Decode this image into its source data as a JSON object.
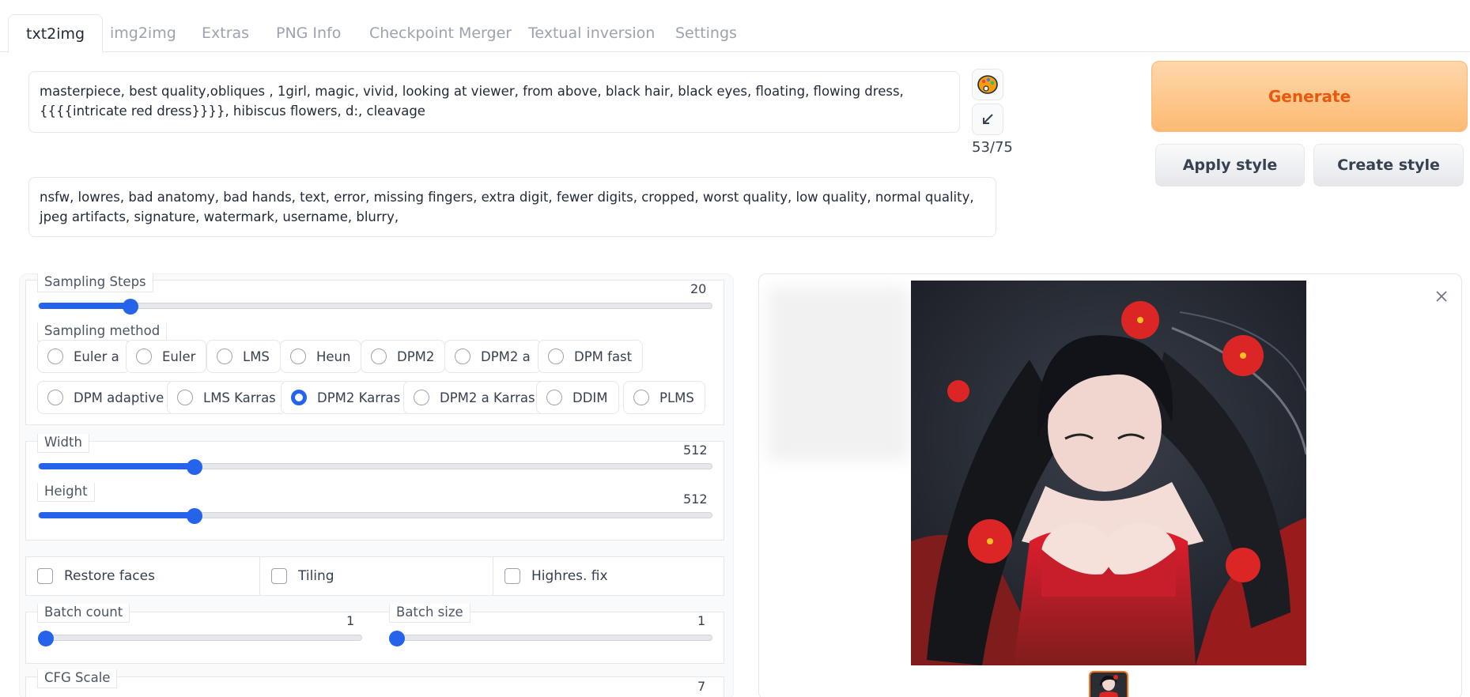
{
  "tabs": [
    {
      "label": "txt2img",
      "active": true
    },
    {
      "label": "img2img"
    },
    {
      "label": "Extras"
    },
    {
      "label": "PNG Info"
    },
    {
      "label": "Checkpoint Merger"
    },
    {
      "label": "Textual inversion"
    },
    {
      "label": "Settings"
    }
  ],
  "prompt": {
    "value": "masterpiece, best quality,obliques , 1girl, magic, vivid, looking at viewer, from above, black hair, black eyes, floating, flowing dress, {{{{intricate red dress}}}}, hibiscus flowers, d:, cleavage",
    "token_count": "53/75"
  },
  "negative_prompt": {
    "value": "nsfw, lowres, bad anatomy, bad hands, text, error, missing fingers, extra digit, fewer digits, cropped, worst quality, low quality, normal quality, jpeg artifacts, signature, watermark, username, blurry,"
  },
  "buttons": {
    "generate": "Generate",
    "apply_style": "Apply style",
    "create_style": "Create style"
  },
  "icons": {
    "palette": "palette-icon",
    "arrow": "arrow-down-left-icon",
    "close": "close-icon"
  },
  "sampling_steps": {
    "label": "Sampling Steps",
    "value": "20",
    "min": 1,
    "max": 150
  },
  "sampling_method": {
    "label": "Sampling method",
    "options": [
      "Euler a",
      "Euler",
      "LMS",
      "Heun",
      "DPM2",
      "DPM2 a",
      "DPM fast",
      "DPM adaptive",
      "LMS Karras",
      "DPM2 Karras",
      "DPM2 a Karras",
      "DDIM",
      "PLMS"
    ],
    "selected": "DPM2 Karras"
  },
  "width": {
    "label": "Width",
    "value": "512",
    "min": 64,
    "max": 2048
  },
  "height": {
    "label": "Height",
    "value": "512",
    "min": 64,
    "max": 2048
  },
  "checkboxes": {
    "restore_faces": "Restore faces",
    "tiling": "Tiling",
    "highres_fix": "Highres. fix"
  },
  "batch_count": {
    "label": "Batch count",
    "value": "1",
    "min": 1,
    "max": 100
  },
  "batch_size": {
    "label": "Batch size",
    "value": "1",
    "min": 1,
    "max": 8
  },
  "cfg_scale": {
    "label": "CFG Scale",
    "value": "7"
  },
  "colors": {
    "accent": "#2563eb",
    "generate": "#ea580c"
  }
}
